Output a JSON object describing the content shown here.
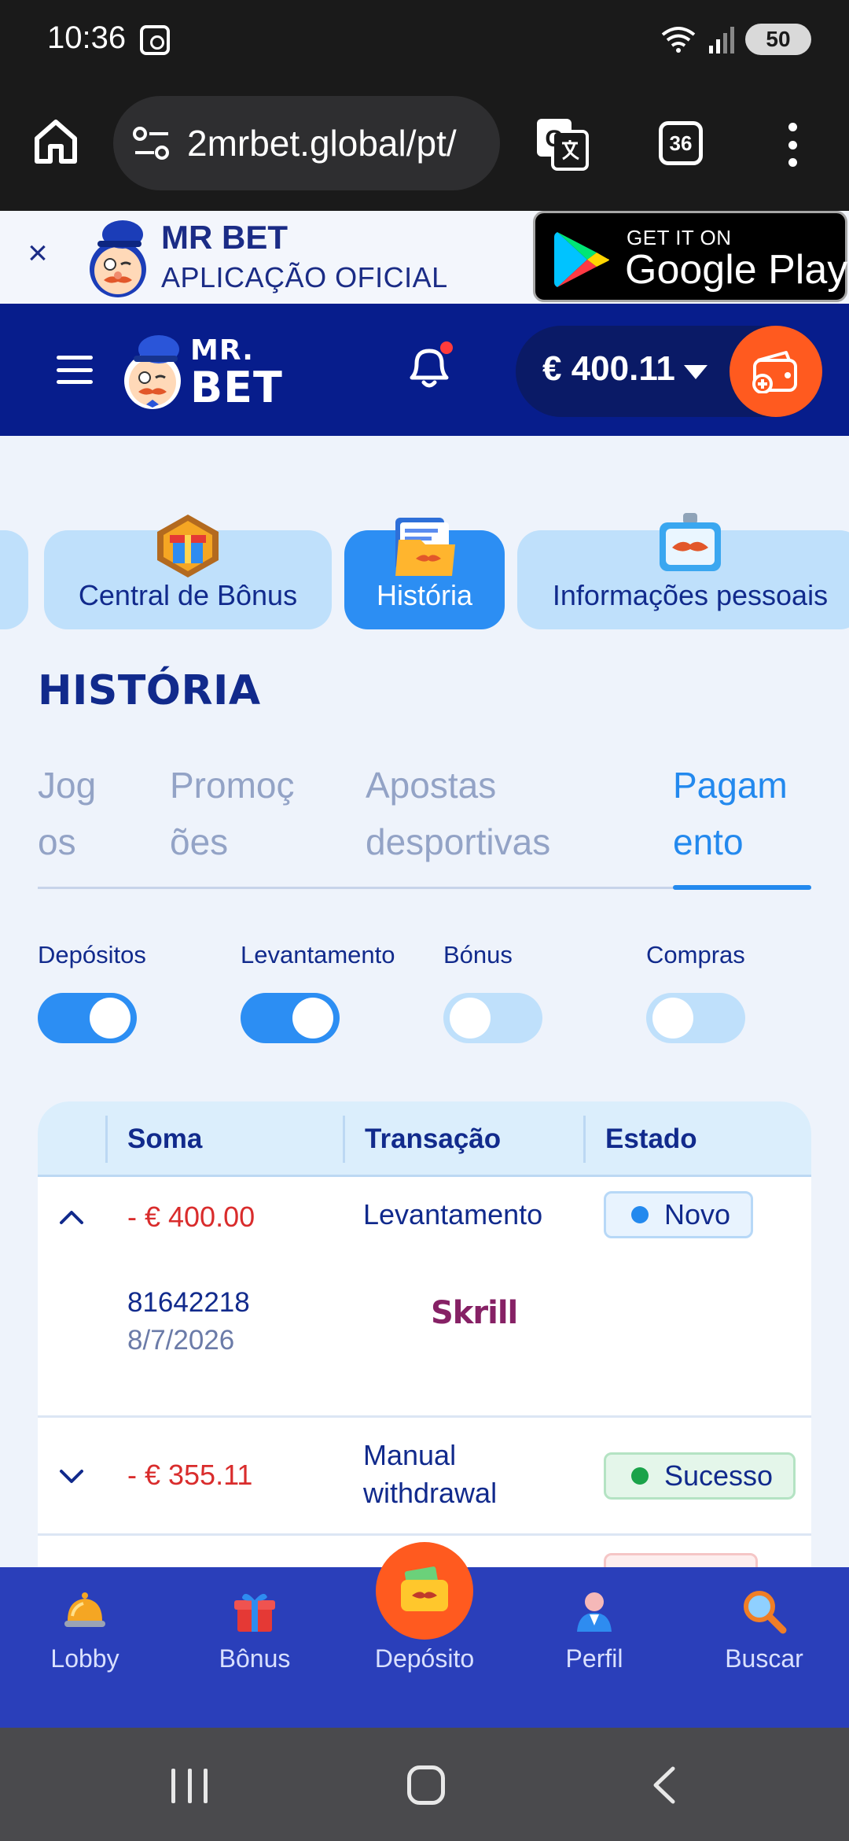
{
  "status_bar": {
    "time": "10:36",
    "battery": "50"
  },
  "browser": {
    "url": "2mrbet.global/pt/",
    "tab_count": "36"
  },
  "app_banner": {
    "close": "×",
    "title": "MR BET",
    "subtitle": "APLICAÇÃO OFICIAL",
    "store_small": "GET IT ON",
    "store_big": "Google Play"
  },
  "header": {
    "logo_line1": "MR.",
    "logo_line2": "BET",
    "balance": "€ 400.11",
    "notification_dot_color": "#ff3b3b"
  },
  "categories": [
    {
      "label": "Central de Bônus",
      "active": false
    },
    {
      "label": "História",
      "active": true
    },
    {
      "label": "Informações pessoais",
      "active": false
    }
  ],
  "page_title": "HISTÓRIA",
  "sub_tabs": [
    {
      "line1": "Jog",
      "line2": "os"
    },
    {
      "line1": "Promoç",
      "line2": "ões"
    },
    {
      "line1": "Apostas",
      "line2": "desportivas"
    },
    {
      "line1": "Pagam",
      "line2": "ento",
      "active": true
    }
  ],
  "filters": [
    {
      "label": "Depósitos",
      "on": true
    },
    {
      "label": "Levantamento",
      "on": true
    },
    {
      "label": "Bónus",
      "on": false
    },
    {
      "label": "Compras",
      "on": false
    }
  ],
  "table": {
    "headers": [
      "Soma",
      "Transação",
      "Estado"
    ],
    "rows": [
      {
        "amount": "- € 400.00",
        "transaction": "Levantamento",
        "status": "Novo",
        "expanded": true,
        "id": "81642218",
        "date": "8/7/2026",
        "method": "Skrill"
      },
      {
        "amount": "- € 355.11",
        "transaction_line1": "Manual",
        "transaction_line2": "withdrawal",
        "status": "Sucesso",
        "expanded": false
      }
    ]
  },
  "bottom_nav": [
    {
      "label": "Lobby",
      "icon": "bell-service-icon"
    },
    {
      "label": "Bônus",
      "icon": "gift-icon"
    },
    {
      "label": "Depósito",
      "icon": "wallet-icon"
    },
    {
      "label": "Perfil",
      "icon": "profile-icon"
    },
    {
      "label": "Buscar",
      "icon": "search-icon"
    }
  ],
  "colors": {
    "brand_blue": "#071d8c",
    "accent_orange": "#ff5a1f",
    "active_blue": "#2c8ef3",
    "negative_red": "#d92c2c"
  }
}
